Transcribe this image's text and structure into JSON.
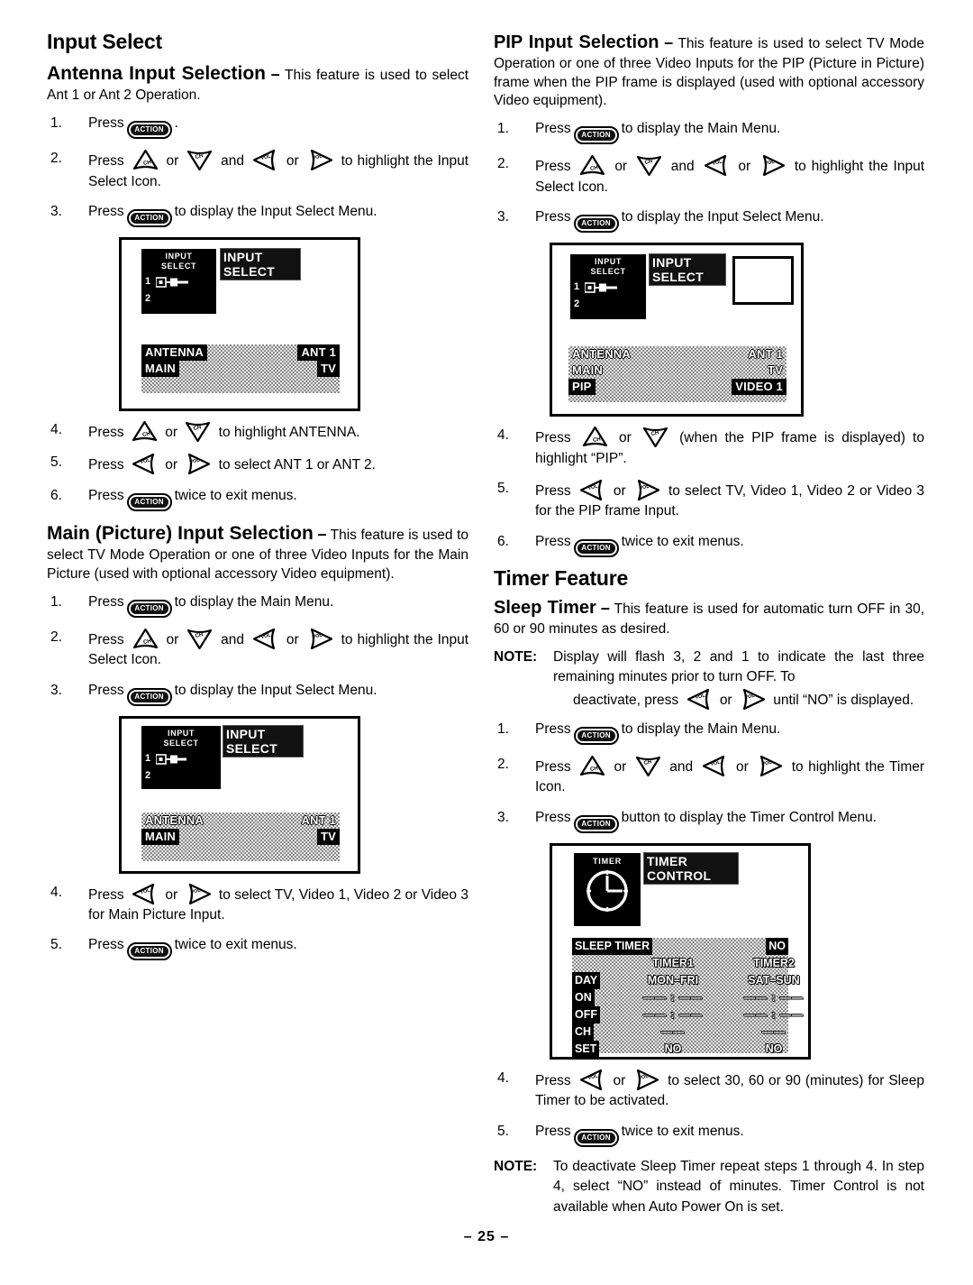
{
  "page": {
    "number": "– 25 –"
  },
  "left": {
    "section_title": "Input Select",
    "antenna": {
      "heading": "Antenna Input Selection",
      "dash": "–",
      "intro": "This feature is used to select Ant 1 or Ant 2 Operation.",
      "steps": [
        {
          "num": "1.",
          "a": "Press",
          "b": ".",
          "keys": [
            "action"
          ]
        },
        {
          "num": "2.",
          "a": "Press",
          "b": "or",
          "c": "and",
          "d": "or",
          "e": "to highlight the Input Select Icon."
        },
        {
          "num": "3.",
          "a": "Press",
          "b": "to display the Input Select Menu."
        },
        {
          "num": "4.",
          "a": "Press",
          "b": "or",
          "c": "to highlight ANTENNA."
        },
        {
          "num": "5.",
          "a": "Press",
          "b": "or",
          "c": "to select ANT 1 or ANT 2."
        },
        {
          "num": "6.",
          "a": "Press",
          "b": "twice to exit menus."
        }
      ]
    },
    "main": {
      "heading": "Main (Picture) Input Selection",
      "dash": "–",
      "intro": "This feature is used to select TV Mode Operation or one of three Video Inputs for the Main Picture (used with optional accessory Video equipment).",
      "steps": [
        {
          "num": "1.",
          "a": "Press",
          "b": "to display the Main Menu."
        },
        {
          "num": "2.",
          "a": "Press",
          "b": "or",
          "c": "and",
          "d": "or",
          "e": "to highlight the Input Select Icon."
        },
        {
          "num": "3.",
          "a": "Press",
          "b": "to display the Input Select Menu."
        },
        {
          "num": "4.",
          "a": "Press",
          "b": "or",
          "c": "to select TV, Video 1, Video 2 or Video 3 for Main Picture Input."
        },
        {
          "num": "5.",
          "a": "Press",
          "b": "twice to exit menus."
        }
      ]
    }
  },
  "right": {
    "pip": {
      "heading": "PIP Input Selection",
      "dash": "–",
      "intro": "This feature is used to select TV Mode Operation or one of three Video Inputs for the PIP (Picture in Picture) frame when the PIP frame is displayed (used with optional accessory Video equipment).",
      "steps": [
        {
          "num": "1.",
          "a": "Press",
          "b": "to display the Main Menu."
        },
        {
          "num": "2.",
          "a": "Press",
          "b": "or",
          "c": "and",
          "d": "or",
          "e": "to highlight the Input Select Icon."
        },
        {
          "num": "3.",
          "a": "Press",
          "b": "to display the Input Select Menu."
        },
        {
          "num": "4.",
          "a": "Press",
          "b": "or",
          "c": "(when the PIP frame is displayed) to highlight “PIP”."
        },
        {
          "num": "5.",
          "a": "Press",
          "b": "or",
          "c": "to select TV, Video 1, Video 2 or Video 3 for the PIP frame Input."
        },
        {
          "num": "6.",
          "a": "Press",
          "b": "twice to exit menus."
        }
      ]
    },
    "timer": {
      "section_title": "Timer Feature",
      "heading": "Sleep Timer",
      "dash": "–",
      "intro": "This feature is used for automatic turn OFF in 30, 60 or 90 minutes as desired.",
      "note1_label": "NOTE:",
      "note1_a": "Display will flash 3, 2 and 1 to indicate the last three remaining minutes prior to turn OFF. To",
      "note1_b": "deactivate, press",
      "note1_c": "or",
      "note1_d": "until “NO” is displayed.",
      "steps": [
        {
          "num": "1.",
          "a": "Press",
          "b": "to display the Main Menu."
        },
        {
          "num": "2.",
          "a": "Press",
          "b": "or",
          "c": "and",
          "d": "or",
          "e": "to highlight the Timer Icon."
        },
        {
          "num": "3.",
          "a": "Press",
          "b": "button to display the Timer Control Menu."
        },
        {
          "num": "4.",
          "a": "Press",
          "b": "or",
          "c": "to select 30, 60 or 90 (minutes) for Sleep Timer to be activated."
        },
        {
          "num": "5.",
          "a": "Press",
          "b": "twice to exit menus."
        }
      ],
      "note2_label": "NOTE:",
      "note2_text": "To deactivate Sleep Timer repeat steps 1 through 4. In step 4, select “NO” instead of minutes. Timer Control is not available when Auto Power On is set."
    }
  },
  "keys": {
    "action_label": "ACTION",
    "ch_up": "CH",
    "ch_down": "CH",
    "vol_down": "VOL",
    "vol_up": "VOL"
  },
  "diagrams": {
    "input_select_antenna": {
      "icon_line1": "INPUT",
      "icon_line2": "SELECT",
      "icon_num1": "1",
      "icon_num2": "2",
      "title_line1": "INPUT",
      "title_line2": "SELECT",
      "rows": [
        {
          "label": "ANTENNA",
          "value": "ANT 1",
          "highlight": true
        },
        {
          "label": "MAIN",
          "value": "TV",
          "highlight": false
        }
      ]
    },
    "input_select_main": {
      "icon_line1": "INPUT",
      "icon_line2": "SELECT",
      "icon_num1": "1",
      "icon_num2": "2",
      "title_line1": "INPUT",
      "title_line2": "SELECT",
      "rows": [
        {
          "label": "ANTENNA",
          "value": "ANT 1",
          "highlight": false
        },
        {
          "label": "MAIN",
          "value": "TV",
          "highlight": true
        }
      ]
    },
    "input_select_pip": {
      "icon_line1": "INPUT",
      "icon_line2": "SELECT",
      "icon_num1": "1",
      "icon_num2": "2",
      "title_line1": "INPUT",
      "title_line2": "SELECT",
      "rows": [
        {
          "label": "ANTENNA",
          "value": "ANT 1",
          "highlight": false
        },
        {
          "label": "MAIN",
          "value": "TV",
          "highlight": false
        },
        {
          "label": "PIP",
          "value": "VIDEO 1",
          "highlight": true
        }
      ]
    },
    "timer_control": {
      "icon_label": "TIMER",
      "title_line1": "TIMER",
      "title_line2": "CONTROL",
      "sleep_label": "SLEEP TIMER",
      "sleep_value": "NO",
      "col1_header": "TIMER1",
      "col2_header": "TIMER2",
      "rows": [
        {
          "label": "DAY",
          "c1": "MON–FRI",
          "c2": "SAT–SUN"
        },
        {
          "label": "ON",
          "c1": "—— : ——",
          "c2": "—— : ——"
        },
        {
          "label": "OFF",
          "c1": "—— : ——",
          "c2": "—— : ——"
        },
        {
          "label": "CH",
          "c1": "——",
          "c2": "——"
        },
        {
          "label": "SET",
          "c1": "NO",
          "c2": "NO"
        }
      ]
    }
  }
}
